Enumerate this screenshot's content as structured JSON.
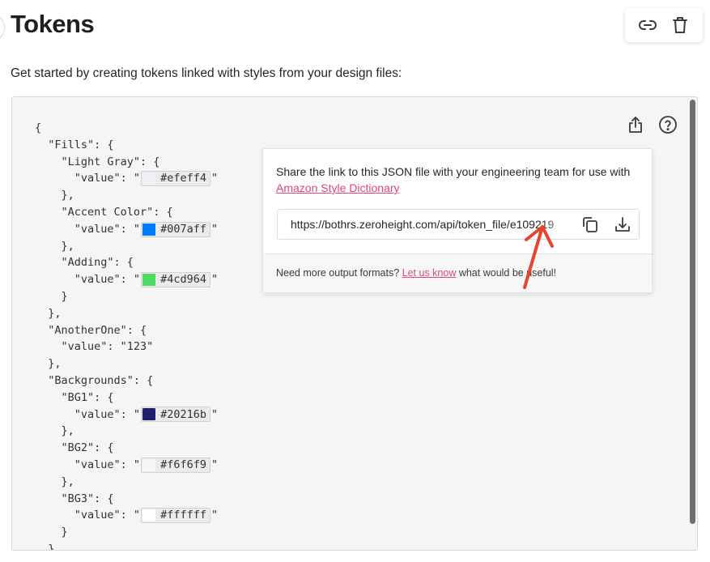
{
  "header": {
    "title": "Tokens",
    "subtitle": "Get started by creating tokens linked with styles from your design files:",
    "actions": [
      {
        "name": "copy-link",
        "icon": "link-icon"
      },
      {
        "name": "delete",
        "icon": "trash-icon"
      }
    ]
  },
  "code_panel": {
    "icons": [
      {
        "name": "export",
        "icon": "share-upload-icon"
      },
      {
        "name": "help",
        "icon": "help-circle-icon"
      }
    ],
    "lines": [
      {
        "indent": 0,
        "text": "{"
      },
      {
        "indent": 1,
        "text": "\"Fills\": {"
      },
      {
        "indent": 2,
        "text": "\"Light Gray\": {"
      },
      {
        "indent": 3,
        "prefix": "\"value\": \"",
        "color": "#efeff4",
        "suffix": "\""
      },
      {
        "indent": 2,
        "text": "},"
      },
      {
        "indent": 2,
        "text": "\"Accent Color\": {"
      },
      {
        "indent": 3,
        "prefix": "\"value\": \"",
        "color": "#007aff",
        "suffix": "\""
      },
      {
        "indent": 2,
        "text": "},"
      },
      {
        "indent": 2,
        "text": "\"Adding\": {"
      },
      {
        "indent": 3,
        "prefix": "\"value\": \"",
        "color": "#4cd964",
        "suffix": "\""
      },
      {
        "indent": 2,
        "text": "}"
      },
      {
        "indent": 1,
        "text": "},"
      },
      {
        "indent": 1,
        "text": "\"AnotherOne\": {"
      },
      {
        "indent": 2,
        "text": "\"value\": \"123\""
      },
      {
        "indent": 1,
        "text": "},"
      },
      {
        "indent": 1,
        "text": "\"Backgrounds\": {"
      },
      {
        "indent": 2,
        "text": "\"BG1\": {"
      },
      {
        "indent": 3,
        "prefix": "\"value\": \"",
        "color": "#20216b",
        "suffix": "\""
      },
      {
        "indent": 2,
        "text": "},"
      },
      {
        "indent": 2,
        "text": "\"BG2\": {"
      },
      {
        "indent": 3,
        "prefix": "\"value\": \"",
        "color": "#f6f6f9",
        "suffix": "\""
      },
      {
        "indent": 2,
        "text": "},"
      },
      {
        "indent": 2,
        "text": "\"BG3\": {"
      },
      {
        "indent": 3,
        "prefix": "\"value\": \"",
        "color": "#ffffff",
        "suffix": "\""
      },
      {
        "indent": 2,
        "text": "}"
      },
      {
        "indent": 1,
        "text": "}"
      }
    ]
  },
  "popover": {
    "desc_prefix": "Share the link to this JSON file with your engineering team for use with ",
    "desc_link": "Amazon Style Dictionary",
    "url_value": "https://bothrs.zeroheight.com/api/token_file/e109219",
    "url_icons": [
      {
        "name": "copy",
        "icon": "copy-icon"
      },
      {
        "name": "download",
        "icon": "download-icon"
      }
    ],
    "footer_prefix": "Need more output formats? ",
    "footer_link": "Let us know",
    "footer_suffix": " what would be useful!"
  },
  "annotation": {
    "type": "arrow",
    "color": "#e8432c"
  },
  "colors": {
    "link": "#e0457b",
    "panel_bg": "#f5f5f5"
  }
}
